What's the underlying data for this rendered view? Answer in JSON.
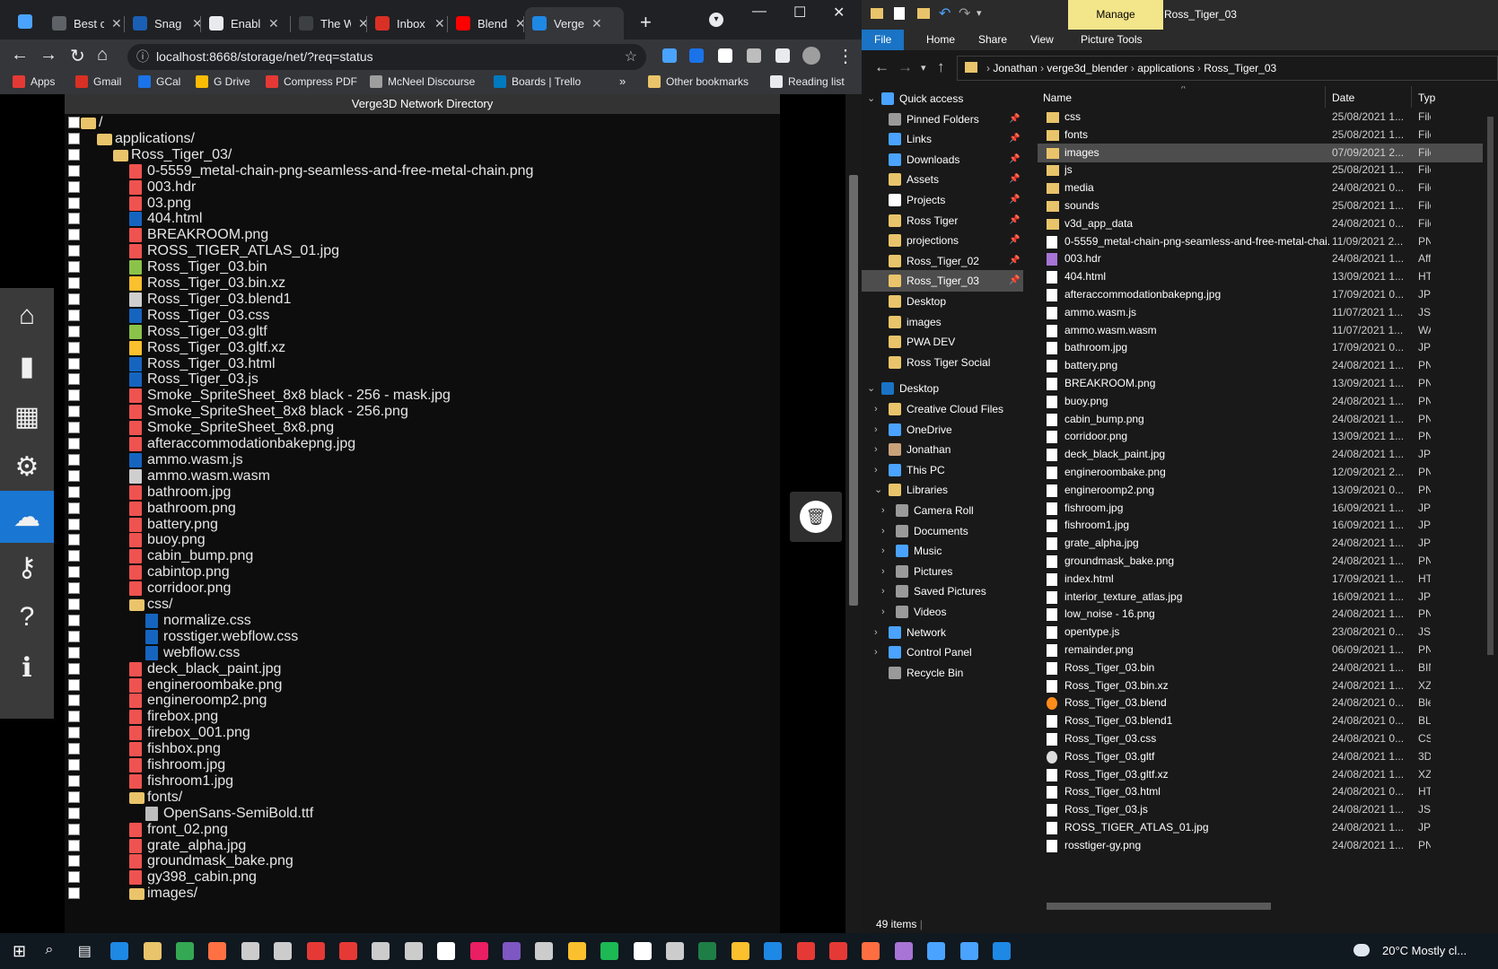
{
  "chrome": {
    "tabs": [
      {
        "title": "Best c",
        "color": "#5f6368"
      },
      {
        "title": "Snag",
        "color": "#1a5fb4"
      },
      {
        "title": "Enabl",
        "color": "#e8eaed"
      },
      {
        "title": "The W",
        "color": "#3c4043"
      },
      {
        "title": "Inbox",
        "color": "#d93025"
      },
      {
        "title": "Blend",
        "color": "#ff0000"
      },
      {
        "title": "Verge",
        "color": "#1e88e5"
      }
    ],
    "url": "localhost:8668/storage/net/?req=status",
    "bookmarks": [
      "Apps",
      "Gmail",
      "GCal",
      "G Drive",
      "Compress PDF",
      "McNeel Discourse",
      "Boards | Trello",
      "Other bookmarks",
      "Reading list"
    ]
  },
  "verge": {
    "title": "Verge3D Network Directory",
    "tree": [
      {
        "name": "/",
        "indent": 0,
        "type": "folder"
      },
      {
        "name": "applications/",
        "indent": 1,
        "type": "folder"
      },
      {
        "name": "Ross_Tiger_03/",
        "indent": 2,
        "type": "folder"
      },
      {
        "name": "0-5559_metal-chain-png-seamless-and-free-metal-chain.png",
        "indent": 3,
        "type": "img"
      },
      {
        "name": "003.hdr",
        "indent": 3,
        "type": "img"
      },
      {
        "name": "03.png",
        "indent": 3,
        "type": "img"
      },
      {
        "name": "404.html",
        "indent": 3,
        "type": "code"
      },
      {
        "name": "BREAKROOM.png",
        "indent": 3,
        "type": "img"
      },
      {
        "name": "ROSS_TIGER_ATLAS_01.jpg",
        "indent": 3,
        "type": "img"
      },
      {
        "name": "Ross_Tiger_03.bin",
        "indent": 3,
        "type": "bin"
      },
      {
        "name": "Ross_Tiger_03.bin.xz",
        "indent": 3,
        "type": "arch"
      },
      {
        "name": "Ross_Tiger_03.blend1",
        "indent": 3,
        "type": "plain"
      },
      {
        "name": "Ross_Tiger_03.css",
        "indent": 3,
        "type": "code"
      },
      {
        "name": "Ross_Tiger_03.gltf",
        "indent": 3,
        "type": "bin"
      },
      {
        "name": "Ross_Tiger_03.gltf.xz",
        "indent": 3,
        "type": "arch"
      },
      {
        "name": "Ross_Tiger_03.html",
        "indent": 3,
        "type": "code"
      },
      {
        "name": "Ross_Tiger_03.js",
        "indent": 3,
        "type": "code"
      },
      {
        "name": "Smoke_SpriteSheet_8x8 black - 256 - mask.jpg",
        "indent": 3,
        "type": "img"
      },
      {
        "name": "Smoke_SpriteSheet_8x8 black - 256.png",
        "indent": 3,
        "type": "img"
      },
      {
        "name": "Smoke_SpriteSheet_8x8.png",
        "indent": 3,
        "type": "img"
      },
      {
        "name": "afteraccommodationbakepng.jpg",
        "indent": 3,
        "type": "img"
      },
      {
        "name": "ammo.wasm.js",
        "indent": 3,
        "type": "code"
      },
      {
        "name": "ammo.wasm.wasm",
        "indent": 3,
        "type": "plain"
      },
      {
        "name": "bathroom.jpg",
        "indent": 3,
        "type": "img"
      },
      {
        "name": "bathroom.png",
        "indent": 3,
        "type": "img"
      },
      {
        "name": "battery.png",
        "indent": 3,
        "type": "img"
      },
      {
        "name": "buoy.png",
        "indent": 3,
        "type": "img"
      },
      {
        "name": "cabin_bump.png",
        "indent": 3,
        "type": "img"
      },
      {
        "name": "cabintop.png",
        "indent": 3,
        "type": "img"
      },
      {
        "name": "corridoor.png",
        "indent": 3,
        "type": "img"
      },
      {
        "name": "css/",
        "indent": 3,
        "type": "folder"
      },
      {
        "name": "normalize.css",
        "indent": 4,
        "type": "code"
      },
      {
        "name": "rosstiger.webflow.css",
        "indent": 4,
        "type": "code"
      },
      {
        "name": "webflow.css",
        "indent": 4,
        "type": "code"
      },
      {
        "name": "deck_black_paint.jpg",
        "indent": 3,
        "type": "img"
      },
      {
        "name": "engineroombake.png",
        "indent": 3,
        "type": "img"
      },
      {
        "name": "engineroomp2.png",
        "indent": 3,
        "type": "img"
      },
      {
        "name": "firebox.png",
        "indent": 3,
        "type": "img"
      },
      {
        "name": "firebox_001.png",
        "indent": 3,
        "type": "img"
      },
      {
        "name": "fishbox.png",
        "indent": 3,
        "type": "img"
      },
      {
        "name": "fishroom.jpg",
        "indent": 3,
        "type": "img"
      },
      {
        "name": "fishroom1.jpg",
        "indent": 3,
        "type": "img"
      },
      {
        "name": "fonts/",
        "indent": 3,
        "type": "folder"
      },
      {
        "name": "OpenSans-SemiBold.ttf",
        "indent": 4,
        "type": "font"
      },
      {
        "name": "front_02.png",
        "indent": 3,
        "type": "img"
      },
      {
        "name": "grate_alpha.jpg",
        "indent": 3,
        "type": "img"
      },
      {
        "name": "groundmask_bake.png",
        "indent": 3,
        "type": "img"
      },
      {
        "name": "gy398_cabin.png",
        "indent": 3,
        "type": "img"
      },
      {
        "name": "images/",
        "indent": 3,
        "type": "folder"
      }
    ],
    "sidebar_icons": [
      "home-icon",
      "file-icon",
      "table-icon",
      "gear-icon",
      "cloud-icon",
      "key-icon",
      "help-icon",
      "info-icon"
    ],
    "sidebar_glyphs": [
      "⌂",
      "▮",
      "▦",
      "⚙",
      "☁",
      "⚷",
      "?",
      "ℹ"
    ],
    "trash_glyph": "🗑"
  },
  "explorer": {
    "ribbon_manage": "Manage",
    "window_title": "Ross_Tiger_03",
    "ribbon_tabs": [
      "File",
      "Home",
      "Share",
      "View",
      "Picture Tools"
    ],
    "breadcrumb": [
      "Jonathan",
      "verge3d_blender",
      "applications",
      "Ross_Tiger_03"
    ],
    "nav": [
      {
        "label": "Quick access",
        "level": 0,
        "icon": "#4aa3ff",
        "chev": "v",
        "pin": false
      },
      {
        "label": "Pinned Folders",
        "level": 1,
        "icon": "#9a9a9a",
        "pin": true
      },
      {
        "label": "Links",
        "level": 1,
        "icon": "#4aa3ff",
        "pin": true
      },
      {
        "label": "Downloads",
        "level": 1,
        "icon": "#4aa3ff",
        "pin": true
      },
      {
        "label": "Assets",
        "level": 1,
        "icon": "#e9c46a",
        "pin": true
      },
      {
        "label": "Projects",
        "level": 1,
        "icon": "#ffffff",
        "pin": true
      },
      {
        "label": "Ross Tiger",
        "level": 1,
        "icon": "#e9c46a",
        "pin": true
      },
      {
        "label": "projections",
        "level": 1,
        "icon": "#e9c46a",
        "pin": true
      },
      {
        "label": "Ross_Tiger_02",
        "level": 1,
        "icon": "#e9c46a",
        "pin": true
      },
      {
        "label": "Ross_Tiger_03",
        "level": 1,
        "icon": "#e9c46a",
        "pin": true,
        "sel": true
      },
      {
        "label": "Desktop",
        "level": 1,
        "icon": "#e9c46a",
        "pin": false
      },
      {
        "label": "images",
        "level": 1,
        "icon": "#e9c46a",
        "pin": false
      },
      {
        "label": "PWA DEV",
        "level": 1,
        "icon": "#e9c46a",
        "pin": false
      },
      {
        "label": "Ross Tiger Social",
        "level": 1,
        "icon": "#e9c46a",
        "pin": false
      },
      {
        "label": "Desktop",
        "level": 0,
        "icon": "#1a73c4",
        "chev": "v",
        "pin": false,
        "gap": true
      },
      {
        "label": "Creative Cloud Files",
        "level": 1,
        "icon": "#e9c46a",
        "chev": ">",
        "pin": false
      },
      {
        "label": "OneDrive",
        "level": 1,
        "icon": "#4aa3ff",
        "chev": ">",
        "pin": false
      },
      {
        "label": "Jonathan",
        "level": 1,
        "icon": "#c9a27a",
        "chev": ">",
        "pin": false
      },
      {
        "label": "This PC",
        "level": 1,
        "icon": "#4aa3ff",
        "chev": ">",
        "pin": false
      },
      {
        "label": "Libraries",
        "level": 1,
        "icon": "#e9c46a",
        "chev": "v",
        "pin": false
      },
      {
        "label": "Camera Roll",
        "level": 2,
        "icon": "#9a9a9a",
        "chev": ">",
        "pin": false
      },
      {
        "label": "Documents",
        "level": 2,
        "icon": "#9a9a9a",
        "chev": ">",
        "pin": false
      },
      {
        "label": "Music",
        "level": 2,
        "icon": "#4aa3ff",
        "chev": ">",
        "pin": false
      },
      {
        "label": "Pictures",
        "level": 2,
        "icon": "#9a9a9a",
        "chev": ">",
        "pin": false
      },
      {
        "label": "Saved Pictures",
        "level": 2,
        "icon": "#9a9a9a",
        "chev": ">",
        "pin": false
      },
      {
        "label": "Videos",
        "level": 2,
        "icon": "#9a9a9a",
        "chev": ">",
        "pin": false
      },
      {
        "label": "Network",
        "level": 1,
        "icon": "#4aa3ff",
        "chev": ">",
        "pin": false
      },
      {
        "label": "Control Panel",
        "level": 1,
        "icon": "#4aa3ff",
        "chev": ">",
        "pin": false
      },
      {
        "label": "Recycle Bin",
        "level": 1,
        "icon": "#9a9a9a",
        "pin": false
      }
    ],
    "columns": [
      "Name",
      "Date",
      "Typ"
    ],
    "files": [
      {
        "name": "css",
        "date": "25/08/2021 1...",
        "type": "File",
        "icon": "fold"
      },
      {
        "name": "fonts",
        "date": "25/08/2021 1...",
        "type": "File",
        "icon": "fold"
      },
      {
        "name": "images",
        "date": "07/09/2021 2...",
        "type": "File",
        "icon": "fold",
        "sel": true
      },
      {
        "name": "js",
        "date": "25/08/2021 1...",
        "type": "File",
        "icon": "fold"
      },
      {
        "name": "media",
        "date": "24/08/2021 0...",
        "type": "File",
        "icon": "fold"
      },
      {
        "name": "sounds",
        "date": "25/08/2021 1...",
        "type": "File",
        "icon": "fold"
      },
      {
        "name": "v3d_app_data",
        "date": "24/08/2021 0...",
        "type": "File",
        "icon": "fold"
      },
      {
        "name": "0-5559_metal-chain-png-seamless-and-free-metal-chai...",
        "date": "11/09/2021 2...",
        "type": "PN",
        "icon": "doc"
      },
      {
        "name": "003.hdr",
        "date": "24/08/2021 1...",
        "type": "Aff",
        "icon": "hdr"
      },
      {
        "name": "404.html",
        "date": "13/09/2021 1...",
        "type": "HT",
        "icon": "doc"
      },
      {
        "name": "afteraccommodationbakepng.jpg",
        "date": "17/09/2021 0...",
        "type": "JPG",
        "icon": "doc"
      },
      {
        "name": "ammo.wasm.js",
        "date": "11/07/2021 1...",
        "type": "JS I",
        "icon": "doc"
      },
      {
        "name": "ammo.wasm.wasm",
        "date": "11/07/2021 1...",
        "type": "WA",
        "icon": "doc"
      },
      {
        "name": "bathroom.jpg",
        "date": "17/09/2021 0...",
        "type": "JPG",
        "icon": "doc"
      },
      {
        "name": "battery.png",
        "date": "24/08/2021 1...",
        "type": "PN",
        "icon": "doc"
      },
      {
        "name": "BREAKROOM.png",
        "date": "13/09/2021 1...",
        "type": "PN",
        "icon": "doc"
      },
      {
        "name": "buoy.png",
        "date": "24/08/2021 1...",
        "type": "PN",
        "icon": "doc"
      },
      {
        "name": "cabin_bump.png",
        "date": "24/08/2021 1...",
        "type": "PN",
        "icon": "doc"
      },
      {
        "name": "corridoor.png",
        "date": "13/09/2021 1...",
        "type": "PN",
        "icon": "doc"
      },
      {
        "name": "deck_black_paint.jpg",
        "date": "24/08/2021 1...",
        "type": "JPG",
        "icon": "doc"
      },
      {
        "name": "engineroombake.png",
        "date": "12/09/2021 2...",
        "type": "PN",
        "icon": "doc"
      },
      {
        "name": "engineroomp2.png",
        "date": "13/09/2021 0...",
        "type": "PN",
        "icon": "doc"
      },
      {
        "name": "fishroom.jpg",
        "date": "16/09/2021 1...",
        "type": "JPG",
        "icon": "doc"
      },
      {
        "name": "fishroom1.jpg",
        "date": "16/09/2021 1...",
        "type": "JPG",
        "icon": "doc"
      },
      {
        "name": "grate_alpha.jpg",
        "date": "24/08/2021 1...",
        "type": "JPG",
        "icon": "doc"
      },
      {
        "name": "groundmask_bake.png",
        "date": "24/08/2021 1...",
        "type": "PN",
        "icon": "doc"
      },
      {
        "name": "index.html",
        "date": "17/09/2021 1...",
        "type": "HT",
        "icon": "doc"
      },
      {
        "name": "interior_texture_atlas.jpg",
        "date": "16/09/2021 1...",
        "type": "JPG",
        "icon": "doc"
      },
      {
        "name": "low_noise - 16.png",
        "date": "24/08/2021 1...",
        "type": "PN",
        "icon": "doc"
      },
      {
        "name": "opentype.js",
        "date": "23/08/2021 0...",
        "type": "JS I",
        "icon": "doc"
      },
      {
        "name": "remainder.png",
        "date": "06/09/2021 1...",
        "type": "PN",
        "icon": "doc"
      },
      {
        "name": "Ross_Tiger_03.bin",
        "date": "24/08/2021 1...",
        "type": "BIN",
        "icon": "doc"
      },
      {
        "name": "Ross_Tiger_03.bin.xz",
        "date": "24/08/2021 1...",
        "type": "XZ",
        "icon": "doc"
      },
      {
        "name": "Ross_Tiger_03.blend",
        "date": "24/08/2021 0...",
        "type": "Ble",
        "icon": "blend"
      },
      {
        "name": "Ross_Tiger_03.blend1",
        "date": "24/08/2021 0...",
        "type": "BLI",
        "icon": "doc"
      },
      {
        "name": "Ross_Tiger_03.css",
        "date": "24/08/2021 0...",
        "type": "CS",
        "icon": "doc"
      },
      {
        "name": "Ross_Tiger_03.gltf",
        "date": "24/08/2021 1...",
        "type": "3D",
        "icon": "gltf"
      },
      {
        "name": "Ross_Tiger_03.gltf.xz",
        "date": "24/08/2021 1...",
        "type": "XZ",
        "icon": "doc"
      },
      {
        "name": "Ross_Tiger_03.html",
        "date": "24/08/2021 0...",
        "type": "HT",
        "icon": "doc"
      },
      {
        "name": "Ross_Tiger_03.js",
        "date": "24/08/2021 1...",
        "type": "JS I",
        "icon": "doc"
      },
      {
        "name": "ROSS_TIGER_ATLAS_01.jpg",
        "date": "24/08/2021 1...",
        "type": "JPG",
        "icon": "doc"
      },
      {
        "name": "rosstiger-gy.png",
        "date": "24/08/2021 1...",
        "type": "PN",
        "icon": "doc"
      }
    ],
    "status": "49 items"
  },
  "taskbar": {
    "weather": "20°C  Mostly cl...",
    "icon_colors": [
      "#ffffff",
      "#ffffff",
      "#ffffff",
      "#1e88e5",
      "#e9c46a",
      "#34a853",
      "#ff7043",
      "#cccccc",
      "#cccccc",
      "#e53935",
      "#e53935",
      "#cccccc",
      "#cccccc",
      "#ffffff",
      "#e91e63",
      "#7e57c2",
      "#cccccc",
      "#fbc02d",
      "#1db954",
      "#ffffff",
      "#cccccc",
      "#1e7e45",
      "#fbc02d",
      "#1e88e5",
      "#e53935",
      "#e53935",
      "#ff6e40",
      "#a874d6",
      "#4aa3ff",
      "#4aa3ff",
      "#1e88e5"
    ]
  }
}
